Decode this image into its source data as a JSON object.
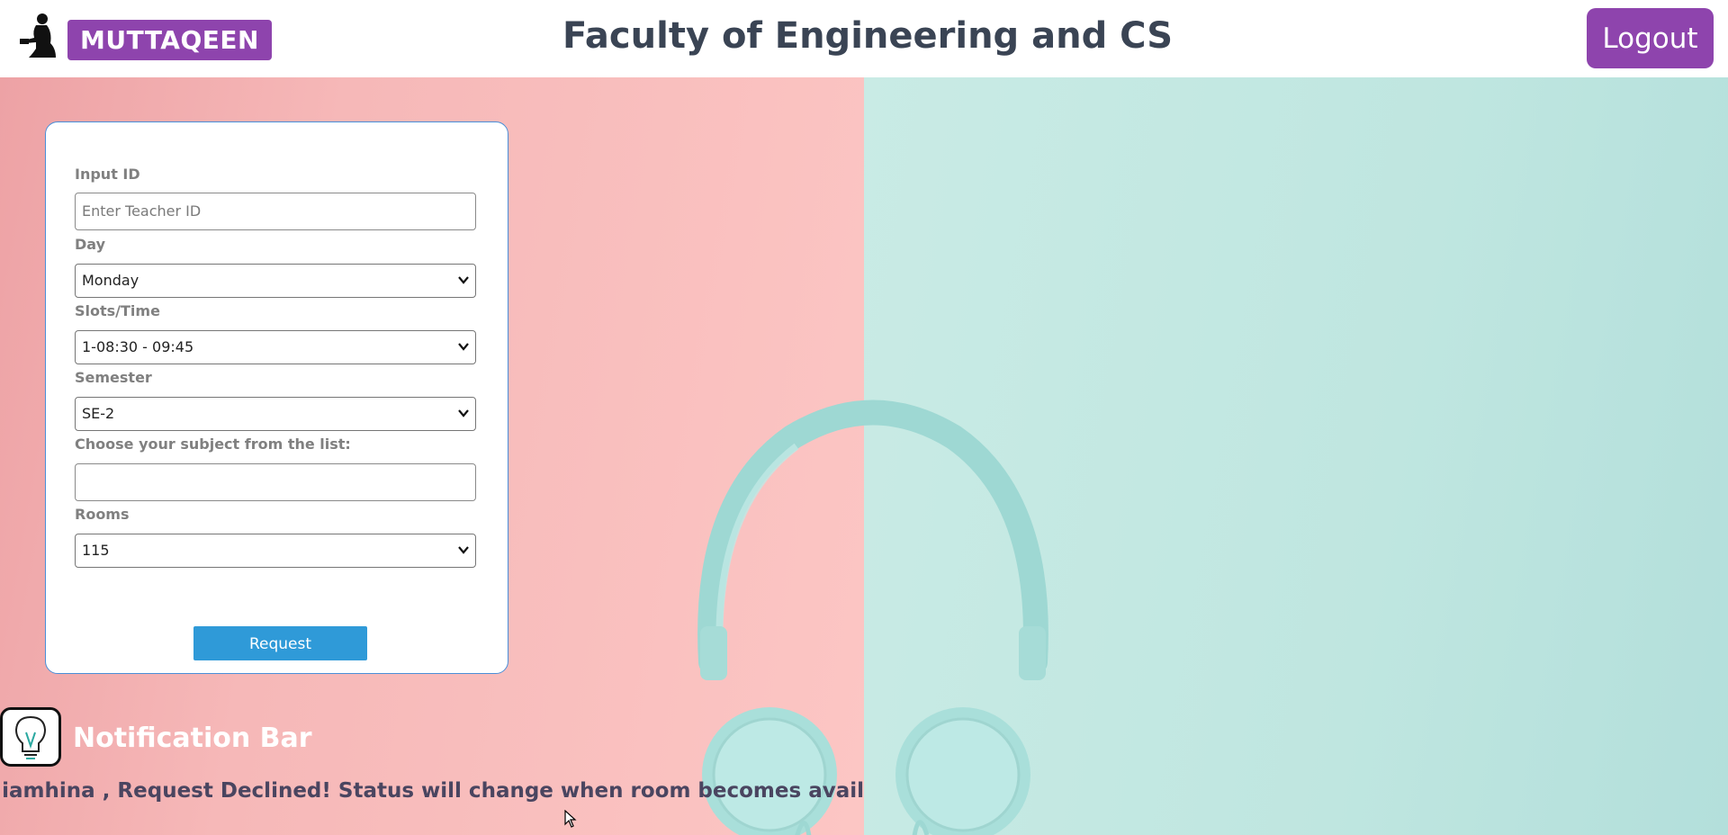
{
  "header": {
    "brand": "MUTTAQEEN",
    "title": "Faculty of Engineering and CS",
    "logout_label": "Logout",
    "accent_color": "#8e44ad"
  },
  "form": {
    "input_id": {
      "label": "Input ID",
      "placeholder": "Enter Teacher ID",
      "value": ""
    },
    "day": {
      "label": "Day",
      "selected": "Monday"
    },
    "slot": {
      "label": "Slots/Time",
      "selected": "1-08:30 - 09:45"
    },
    "semester": {
      "label": "Semester",
      "selected": "SE-2"
    },
    "subject": {
      "label": "Choose your subject from the list:",
      "value": ""
    },
    "rooms": {
      "label": "Rooms",
      "selected": "115"
    },
    "request_label": "Request",
    "button_color": "#2f9ad8"
  },
  "notification": {
    "title": "Notification Bar",
    "message": "Dear! iamhina , Request Declined! Status will change when room becomes avail"
  },
  "icons": [
    "person-logo-icon",
    "lightbulb-icon",
    "chevron-down-icon",
    "mouse-cursor-icon",
    "headphones-image"
  ]
}
